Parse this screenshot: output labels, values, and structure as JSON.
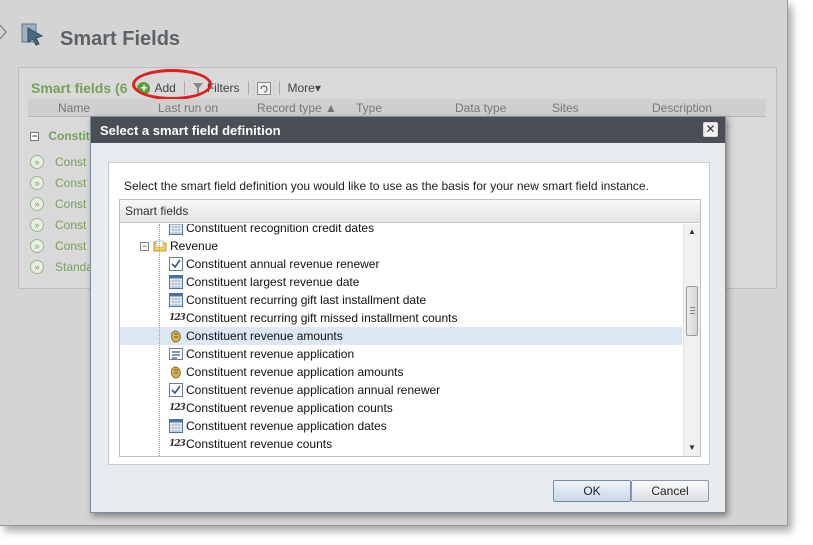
{
  "page": {
    "title": "Smart Fields"
  },
  "panel": {
    "title": "Smart fields (6",
    "add_label": "Add",
    "filters_label": "Filters",
    "more_label": "More▾",
    "columns": [
      "Name",
      "Last run on",
      "Record type ▲",
      "Type",
      "Data type",
      "Sites",
      "Description"
    ],
    "group_label": "Constitu",
    "rows": [
      "Const",
      "Const",
      "Const",
      "Const",
      "Const",
      "Standa"
    ]
  },
  "modal": {
    "title": "Select a smart field definition",
    "close_glyph": "✕",
    "instructions": "Select the smart field definition you would like to use as the basis for your new smart field instance.",
    "tree_header": "Smart fields",
    "ok_label": "OK",
    "cancel_label": "Cancel",
    "tree_items": [
      {
        "label": "Constituent recognition credit dates",
        "icon": "calendar-icon"
      },
      {
        "label": "Revenue",
        "icon": "folder-icon"
      },
      {
        "label": "Constituent annual revenue renewer",
        "icon": "checkbox-icon"
      },
      {
        "label": "Constituent largest revenue date",
        "icon": "calendar-icon"
      },
      {
        "label": "Constituent recurring gift last installment date",
        "icon": "calendar-icon"
      },
      {
        "label": "Constituent recurring gift missed installment counts",
        "icon": "count-icon"
      },
      {
        "label": "Constituent revenue amounts",
        "icon": "money-icon"
      },
      {
        "label": "Constituent revenue application",
        "icon": "list-icon"
      },
      {
        "label": "Constituent revenue application amounts",
        "icon": "money-icon"
      },
      {
        "label": "Constituent revenue application annual renewer",
        "icon": "checkbox-icon"
      },
      {
        "label": "Constituent revenue application counts",
        "icon": "count-icon"
      },
      {
        "label": "Constituent revenue application dates",
        "icon": "calendar-icon"
      },
      {
        "label": "Constituent revenue counts",
        "icon": "count-icon"
      }
    ],
    "selected_item": "Constituent revenue amounts",
    "count_icon_text": "123"
  },
  "colors": {
    "accent_green": "#76a05a",
    "modal_header": "#4a4f55",
    "highlight": "#e02020",
    "selection": "#dde8f5"
  }
}
